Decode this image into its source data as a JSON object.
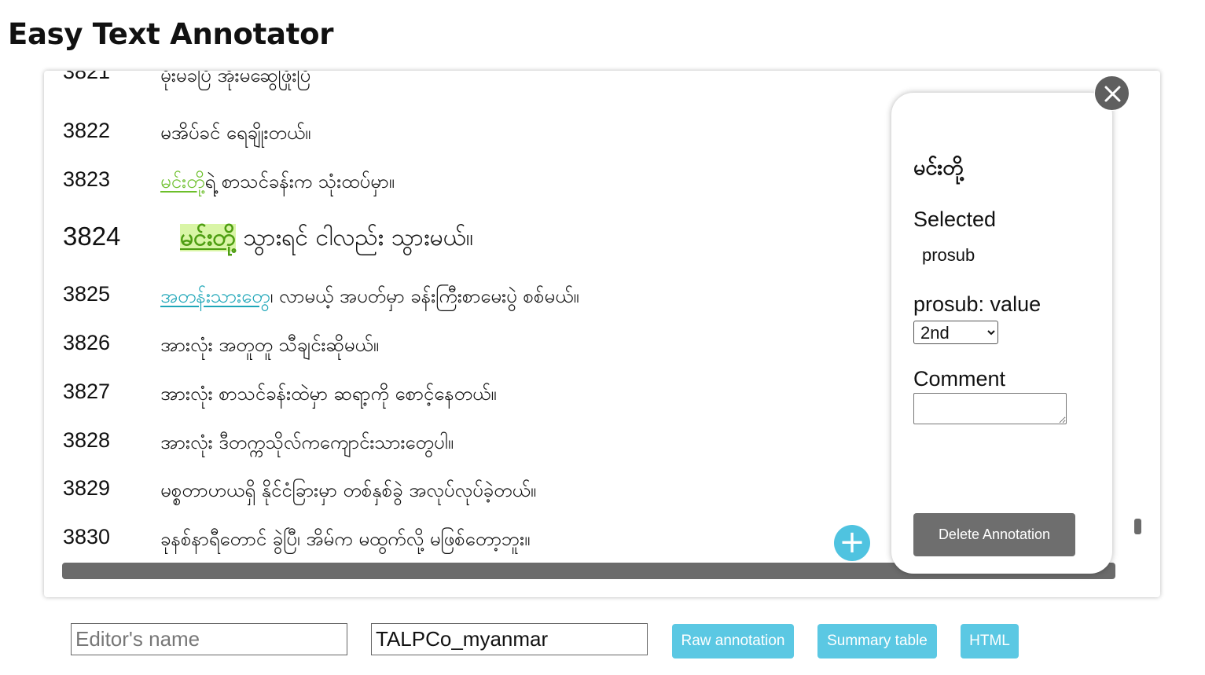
{
  "app": {
    "title": "Easy Text Annotator"
  },
  "lines": [
    {
      "num": "3821",
      "text": "မိုးမခ​ပြီ အိုးမ​ဆွေ​ဖြိုး​ပြီ​"
    },
    {
      "num": "3822",
      "text": "မအိပ်ခင် ရေချိုးတယ်။"
    },
    {
      "num": "3823",
      "ann": "မင်းတို့",
      "rest": "ရဲ့ စာသင်ခန်းက သုံးထပ်မှာ။"
    },
    {
      "num": "3824",
      "ann": "မင်းတို့",
      "rest": " သွားရင် ငါလည်း သွားမယ်။"
    },
    {
      "num": "3825",
      "ann": "အတန်းသားတွေ",
      "rest": "၊ လာမယ့် အပတ်မှာ ခန်းကြီးစာမေးပွဲ စစ်မယ်။"
    },
    {
      "num": "3826",
      "text": "အားလုံး အတူတူ သီချင်းဆိုမယ်။"
    },
    {
      "num": "3827",
      "text": "အားလုံး စာသင်ခန်းထဲမှာ ဆရာ့ကို စောင့်နေတယ်။"
    },
    {
      "num": "3828",
      "text": "အားလုံး ဒီတက္ကသိုလ်ကကျောင်းသားတွေပါ။"
    },
    {
      "num": "3829",
      "text": "မစ္စတာဟယရှိ နိုင်ငံခြားမှာ တစ်နှစ်ခွဲ အလုပ်လုပ်ခဲ့တယ်။"
    },
    {
      "num": "3830",
      "text": "ခုနစ်နာရီတောင် ခွဲပြီ၊ အိမ်က မထွက်လို့ မဖြစ်တော့ဘူး။"
    }
  ],
  "panel": {
    "word": "မင်းတို့",
    "selected_label": "Selected",
    "selected_tag": "prosub",
    "value_label": "prosub: value",
    "value_options": [
      "2nd"
    ],
    "value_selected": "2nd",
    "comment_label": "Comment",
    "comment_value": "",
    "delete_label": "Delete Annotation"
  },
  "footer": {
    "editor_placeholder": "Editor's name",
    "editor_value": "",
    "corpus_value": "TALPCo_myanmar",
    "raw_label": "Raw annotation",
    "summary_label": "Summary table",
    "html_label": "HTML"
  },
  "colors": {
    "annotation_green": "#6cbf2a",
    "annotation_teal": "#1ea6b8",
    "selected_highlight": "#d9f5a6",
    "button_blue": "#5bc8e3",
    "add_button": "#4fc3e0",
    "delete_button": "#6e6e6e"
  },
  "icons": {
    "close": "close-icon",
    "add": "plus-icon",
    "dropdown": "chevron-down-icon"
  }
}
